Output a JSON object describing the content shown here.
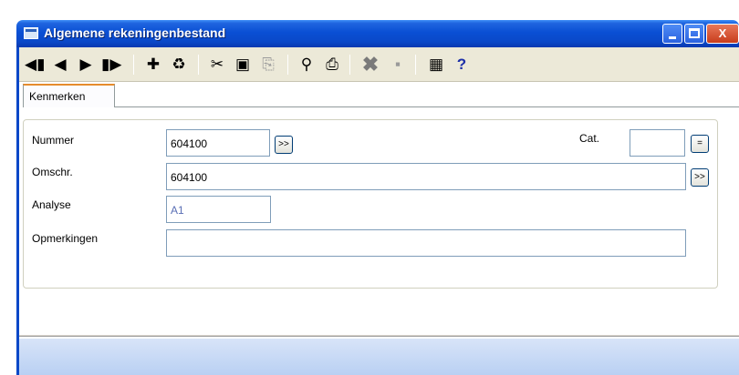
{
  "window": {
    "title": "Algemene rekeningenbestand",
    "minimize_label": "",
    "maximize_label": "",
    "close_label": "X"
  },
  "toolbar": {
    "first": "◀▮",
    "prev": "◀",
    "next": "▶",
    "last": "▮▶",
    "add": "✚",
    "delete": "♻",
    "cut": "✂",
    "edit": "▣",
    "copy": "⎘",
    "search": "⚲",
    "print": "⎙",
    "cancel": "✖",
    "save": "▪",
    "exit": "▦",
    "help": "?"
  },
  "tabs": [
    {
      "label": "Kenmerken",
      "active": true
    }
  ],
  "form": {
    "nummer_label": "Nummer",
    "nummer_value": "604100",
    "omschr_label": "Omschr.",
    "omschr_value": "604100",
    "analyse_label": "Analyse",
    "analyse_value": "A1",
    "opmerkingen_label": "Opmerkingen",
    "opmerkingen_value": "",
    "cat_label": "Cat.",
    "cat_value": "",
    "lookup_button": ">>",
    "cat_button": "="
  }
}
